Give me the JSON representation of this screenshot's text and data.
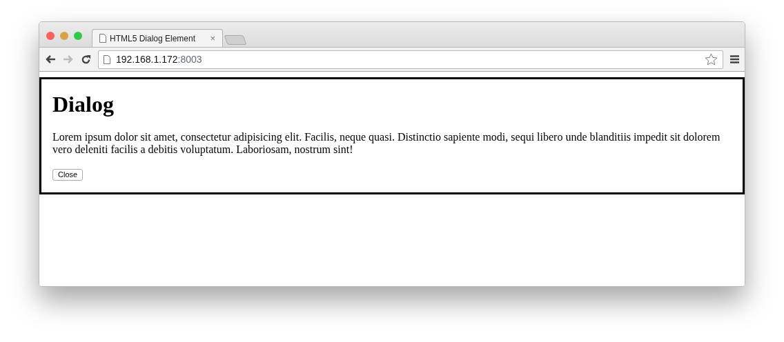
{
  "tabs": [
    {
      "label": "HTML5 Dialog Element",
      "close": "×",
      "selected": true
    }
  ],
  "address_bar": {
    "host": "192.168.1.172",
    "port": ":8003"
  },
  "dialog": {
    "open": true,
    "heading": "Dialog",
    "text": "Lorem ipsum dolor sit amet, consectetur adipisicing elit. Facilis, neque quasi. Distinctio sapiente modi, sequi libero unde blanditiis impedit sit dolorem vero deleniti facilis a debitis voluptatum. Laboriosam, nostrum sint!",
    "button": "Close"
  }
}
